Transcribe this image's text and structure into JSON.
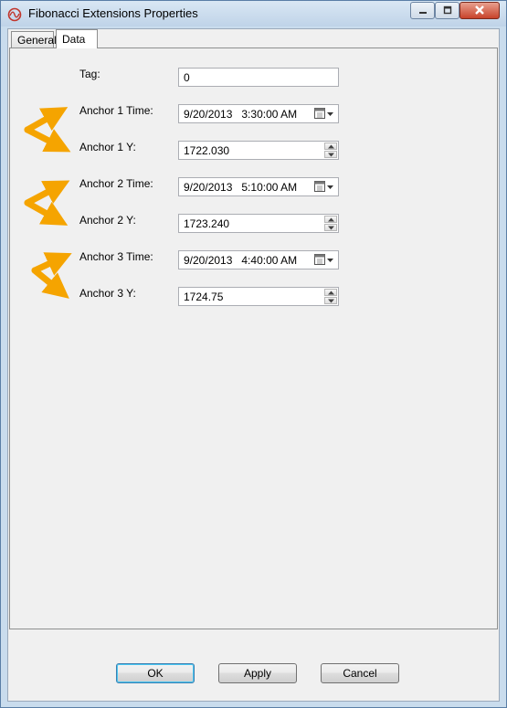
{
  "window": {
    "title": "Fibonacci Extensions Properties"
  },
  "tabs": [
    {
      "label": "General"
    },
    {
      "label": "Data"
    }
  ],
  "fields": {
    "tag": {
      "label": "Tag:",
      "value": "0"
    },
    "anchor1_time": {
      "label": "Anchor 1 Time:",
      "value": "9/20/2013   3:30:00 AM"
    },
    "anchor1_y": {
      "label": "Anchor 1 Y:",
      "value": "1722.030"
    },
    "anchor2_time": {
      "label": "Anchor 2 Time:",
      "value": "9/20/2013   5:10:00 AM"
    },
    "anchor2_y": {
      "label": "Anchor 2 Y:",
      "value": "1723.240"
    },
    "anchor3_time": {
      "label": "Anchor 3 Time:",
      "value": "9/20/2013   4:40:00 AM"
    },
    "anchor3_y": {
      "label": "Anchor 3 Y:",
      "value": "1724.75"
    }
  },
  "buttons": {
    "ok": "OK",
    "apply": "Apply",
    "cancel": "Cancel"
  },
  "colors": {
    "annotation_arrow": "#f5a400",
    "close_button": "#c8432a",
    "selected_tab": "#ffffff"
  },
  "icons": [
    "app-icon",
    "minimize-icon",
    "maximize-icon",
    "close-icon",
    "calendar-icon",
    "spin-up-icon",
    "spin-down-icon"
  ]
}
